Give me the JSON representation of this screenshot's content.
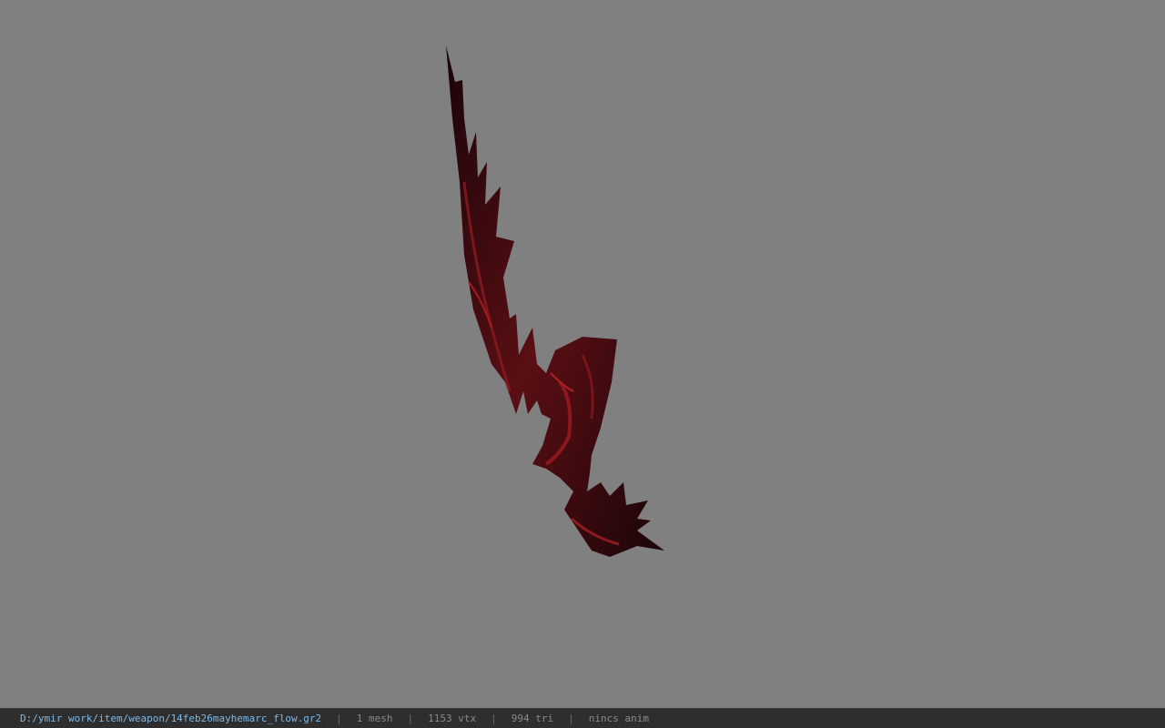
{
  "viewport": {
    "background_color": "#808080",
    "model": {
      "description_icon": "weapon-mesh",
      "colors": {
        "dark": "#1a0508",
        "red": "#8c1a1f"
      }
    }
  },
  "statusbar": {
    "file_path": "D:/ymir work/item/weapon/14feb26mayhemarc_flow.gr2",
    "separator": "|",
    "mesh_count": "1 mesh",
    "vertex_count": "1153 vtx",
    "triangle_count": "994 tri",
    "anim_status": "nincs anim",
    "colors": {
      "path": "#7fb8e6",
      "text": "#8a8a8a",
      "background": "#2e2e2e"
    }
  }
}
